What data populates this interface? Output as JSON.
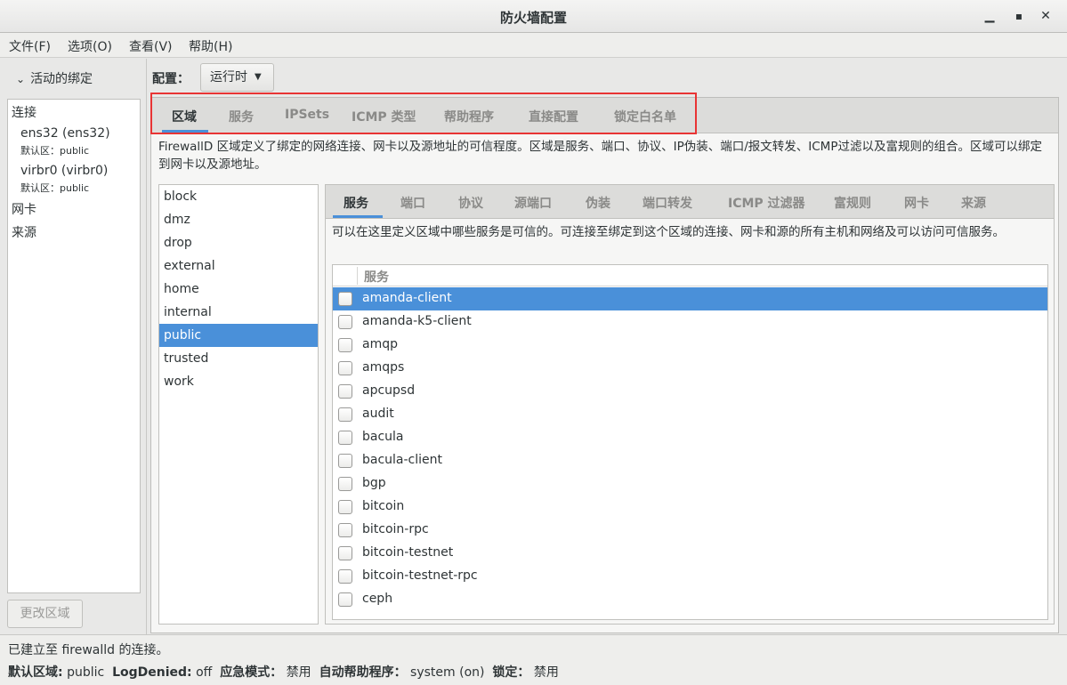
{
  "window": {
    "title": "防火墙配置",
    "minimize": "▁",
    "maximize": "▪",
    "close": "✕"
  },
  "menu": [
    "文件(F)",
    "选项(O)",
    "查看(V)",
    "帮助(H)"
  ],
  "bindings": {
    "header": "活动的绑定",
    "connections_label": "连接",
    "connections": [
      {
        "name": "ens32 (ens32)",
        "zone": "默认区：public"
      },
      {
        "name": "virbr0 (virbr0)",
        "zone": "默认区：public"
      }
    ],
    "interfaces_label": "网卡",
    "sources_label": "来源",
    "change_zone_button": "更改区域"
  },
  "config": {
    "label": "配置：",
    "value": "运行时"
  },
  "main_tabs": [
    "区域",
    "服务",
    "IPSets",
    "ICMP 类型",
    "帮助程序",
    "直接配置",
    "锁定白名单"
  ],
  "main_description": "FirewallD 区域定义了绑定的网络连接、网卡以及源地址的可信程度。区域是服务、端口、协议、IP伪装、端口/报文转发、ICMP过滤以及富规则的组合。区域可以绑定到网卡以及源地址。",
  "zones": [
    "block",
    "dmz",
    "drop",
    "external",
    "home",
    "internal",
    "public",
    "trusted",
    "work"
  ],
  "selected_zone": "public",
  "zone_tabs": [
    "服务",
    "端口",
    "协议",
    "源端口",
    "伪装",
    "端口转发",
    "ICMP 过滤器",
    "富规则",
    "网卡",
    "来源"
  ],
  "services_description": "可以在这里定义区域中哪些服务是可信的。可连接至绑定到这个区域的连接、网卡和源的所有主机和网络及可以访问可信服务。",
  "services_header": "服务",
  "services": [
    "amanda-client",
    "amanda-k5-client",
    "amqp",
    "amqps",
    "apcupsd",
    "audit",
    "bacula",
    "bacula-client",
    "bgp",
    "bitcoin",
    "bitcoin-rpc",
    "bitcoin-testnet",
    "bitcoin-testnet-rpc",
    "ceph"
  ],
  "selected_service": "amanda-client",
  "status": {
    "line1": "已建立至  firewalld 的连接。",
    "default_zone_label": "默认区域:",
    "default_zone_value": "public",
    "log_denied_label": "LogDenied:",
    "log_denied_value": "off",
    "panic_label": "应急模式：",
    "panic_value": "禁用",
    "helper_label": "自动帮助程序：",
    "helper_value": "system (on)",
    "lock_label": "锁定：",
    "lock_value": "禁用"
  },
  "colors": {
    "accent": "#4a90d9",
    "highlight_box": "#e83434"
  }
}
